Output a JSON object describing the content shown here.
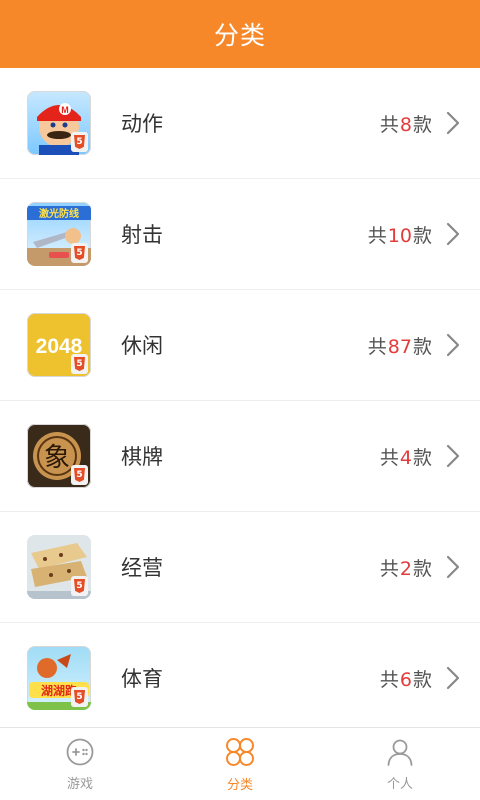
{
  "header": {
    "title": "分类"
  },
  "count_prefix": "共",
  "count_suffix": "款",
  "categories": [
    {
      "name": "动作",
      "count": "8",
      "icon": "mario-game-icon"
    },
    {
      "name": "射击",
      "count": "10",
      "icon": "laser-defense-game-icon",
      "icon_text": "激光防线"
    },
    {
      "name": "休闲",
      "count": "87",
      "icon": "2048-game-icon",
      "icon_text": "2048"
    },
    {
      "name": "棋牌",
      "count": "4",
      "icon": "chinese-chess-game-icon",
      "icon_text": "象"
    },
    {
      "name": "经营",
      "count": "2",
      "icon": "food-business-game-icon"
    },
    {
      "name": "体育",
      "count": "6",
      "icon": "sports-game-icon",
      "icon_text": "湖湖跑"
    }
  ],
  "tabbar": {
    "tabs": [
      {
        "label": "游戏",
        "icon": "gamepad-icon"
      },
      {
        "label": "分类",
        "icon": "category-clover-icon",
        "active": true
      },
      {
        "label": "个人",
        "icon": "person-icon"
      }
    ]
  },
  "colors": {
    "accent": "#f7882a",
    "count_number": "#e23c3c"
  }
}
